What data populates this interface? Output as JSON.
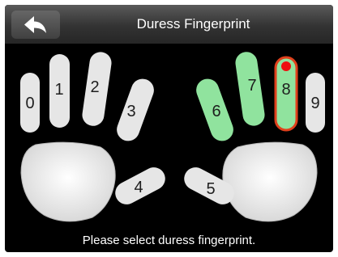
{
  "header": {
    "title": "Duress Fingerprint",
    "back_icon": "back-arrow-icon"
  },
  "fingers": [
    {
      "label": "0",
      "state": "default"
    },
    {
      "label": "1",
      "state": "default"
    },
    {
      "label": "2",
      "state": "default"
    },
    {
      "label": "3",
      "state": "default"
    },
    {
      "label": "4",
      "state": "default"
    },
    {
      "label": "5",
      "state": "default"
    },
    {
      "label": "6",
      "state": "enrolled"
    },
    {
      "label": "7",
      "state": "enrolled"
    },
    {
      "label": "8",
      "state": "selected"
    },
    {
      "label": "9",
      "state": "default"
    }
  ],
  "colors": {
    "default_finger": "#e6e6e6",
    "enrolled_finger": "#90e39e",
    "selected_outline": "#e0401c",
    "selected_marker": "#ee1010",
    "background": "#000000"
  },
  "status": {
    "message": "Please select duress fingerprint."
  }
}
